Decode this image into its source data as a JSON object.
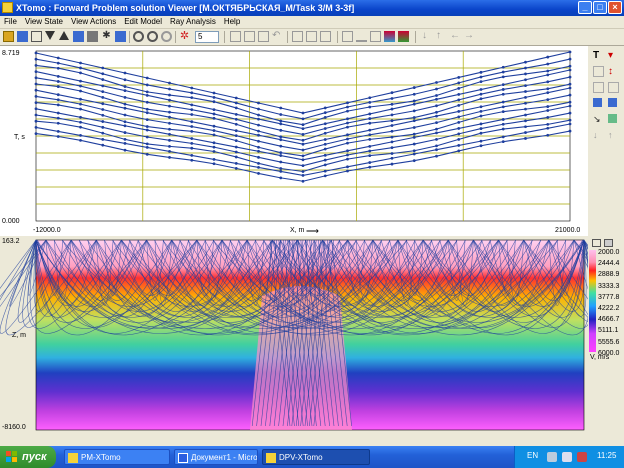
{
  "window": {
    "title": "XTomo : Forward Problem solution Viewer [M.ОКТЯБРЬСКАЯ_M/Task 3/M 3-3f]",
    "min_label": "_",
    "max_label": "□",
    "close_label": "×"
  },
  "menu": [
    "File",
    "View State",
    "View Actions",
    "Edit Model",
    "Ray Analysis",
    "Help"
  ],
  "toolbar": {
    "spin_value": "5"
  },
  "top_plot": {
    "y_label": "T, s",
    "y_max": "8.719",
    "y_min": "0.000",
    "x_min": "-12000.0",
    "x_max": "21000.0",
    "x_label": "X, m"
  },
  "bottom_plot": {
    "y_label": "Z, m",
    "y_top": "163.2",
    "y_bottom": "-8160.0"
  },
  "legend": {
    "ticks": [
      "2000.0",
      "2444.4",
      "2888.9",
      "3333.3",
      "3777.8",
      "4222.2",
      "4666.7",
      "5111.1",
      "5555.6",
      "6000.0"
    ],
    "unit": "V, m/s"
  },
  "taskbar": {
    "start_label": "пуск",
    "tasks": [
      "PM-XTomo",
      "Документ1 - Microso...",
      "DPV-XTomo"
    ],
    "lang": "EN",
    "clock": "11:25"
  },
  "colors": {
    "ray_color": "#1f3f9e",
    "grid_color": "#a8a800"
  }
}
